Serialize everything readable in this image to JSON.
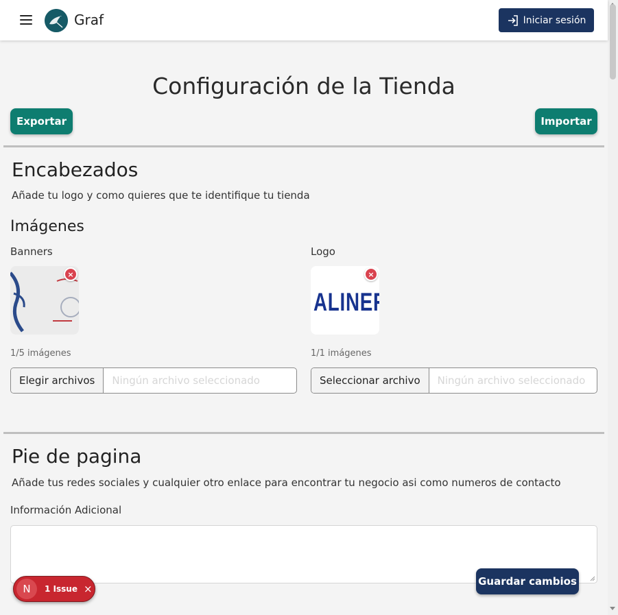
{
  "header": {
    "brand": "Graf",
    "login_label": "Iniciar sesión",
    "menu_icon": "hamburger-icon",
    "login_icon": "sign-in-icon"
  },
  "page": {
    "title": "Configuración de la Tienda",
    "export_label": "Exportar",
    "import_label": "Importar"
  },
  "headers_section": {
    "title": "Encabezados",
    "description": "Añade tu logo y como quieres que te identifique tu tienda",
    "images_title": "Imágenes",
    "banners": {
      "label": "Banners",
      "count": "1/5 imágenes",
      "button": "Elegir archivos",
      "status": "Ningún archivo seleccionado"
    },
    "logo": {
      "label": "Logo",
      "count": "1/1 imágenes",
      "button": "Seleccionar archivo",
      "status": "Ningún archivo seleccionado",
      "image_text": "ALINERI"
    },
    "remove_symbol": "×"
  },
  "footer_section": {
    "title": "Pie de pagina",
    "description": "Añade tus redes sociales y cualquier otro enlace para encontrar tu negocio asi como numeros de contacto",
    "info_label": "Información Adicional",
    "info_value": ""
  },
  "actions": {
    "save_label": "Guardar cambios"
  },
  "dev_overlay": {
    "badge": "N",
    "issues": "1 Issue",
    "close": "×"
  },
  "colors": {
    "navy": "#1b3460",
    "teal": "#0e7d70",
    "danger": "#d9434f"
  }
}
